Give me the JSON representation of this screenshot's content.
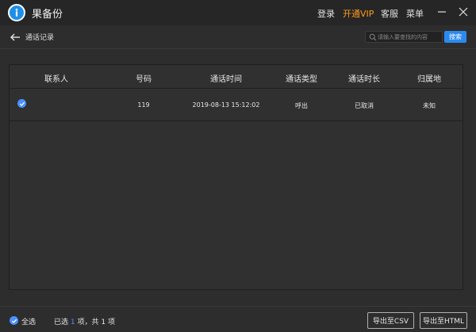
{
  "app": {
    "title": "果备份",
    "menu": {
      "login": "登录",
      "vip": "开通VIP",
      "service": "客服",
      "menu": "菜单"
    }
  },
  "subheader": {
    "title": "通话记录",
    "search_placeholder": "请输入要查找的内容",
    "search_button": "搜索"
  },
  "table": {
    "columns": [
      "联系人",
      "号码",
      "通话时间",
      "通话类型",
      "通话时长",
      "归属地"
    ],
    "rows": [
      {
        "contact": "",
        "number": "119",
        "time": "2019-08-13 15:12:02",
        "type": "呼出",
        "duration": "已取消",
        "location": "未知",
        "checked": true
      }
    ]
  },
  "footer": {
    "select_all": "全选",
    "selected_prefix": "已选",
    "selected_count": "1",
    "selected_suffix": "项，共 1 项",
    "export_csv": "导出至CSV",
    "export_html": "导出至HTML"
  },
  "colors": {
    "accent": "#2b8af0",
    "vip": "#ff9b1e",
    "background": "#2d2d2d"
  }
}
